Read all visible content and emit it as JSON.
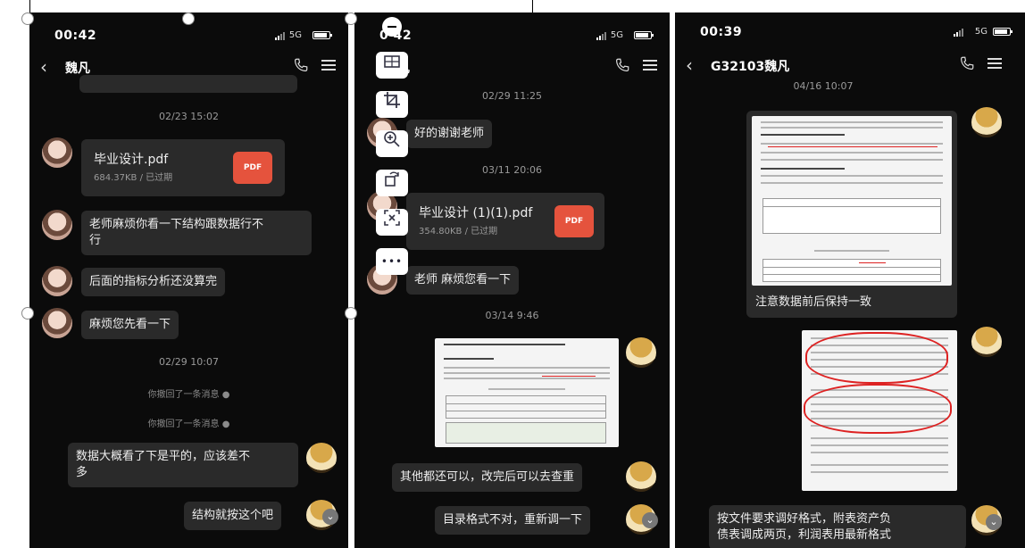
{
  "panel1": {
    "time": "00:42",
    "network": "5G",
    "contact": "魏凡",
    "timestamp1": "02/23 15:02",
    "file": {
      "name": "毕业设计.pdf",
      "meta": "684.37KB / 已过期",
      "icon": "PDF"
    },
    "msg1": "老师麻烦你看一下结构跟数据行不行",
    "msg1_line1": "老师麻烦你看一下结构跟数据行不",
    "msg1_line2": "行",
    "msg2": "后面的指标分析还没算完",
    "msg3": "麻烦您先看一下",
    "timestamp2": "02/29 10:07",
    "recall1": "你撤回了一条消息",
    "recall2": "你撤回了一条消息",
    "msg4_line1": "数据大概看了下是平的，应该差不",
    "msg4_line2": "多",
    "msg5": "结构就按这个吧"
  },
  "panel2": {
    "time": "0 42",
    "network": "5G",
    "contact": "凡",
    "timestamp1": "02/29 11:25",
    "msg1": "好的谢谢老师",
    "timestamp2": "03/11 20:06",
    "file": {
      "name": "毕业设计 (1)(1).pdf",
      "meta": "354.80KB / 已过期",
      "icon": "PDF"
    },
    "msg2": "老师 麻烦您看一下",
    "timestamp3": "03/14 9:46",
    "msg3": "其他都还可以，改完后可以去查重",
    "msg4": "目录格式不对，重新调一下"
  },
  "panel3": {
    "time": "00:39",
    "network": "5G",
    "contact": "G32103魏凡",
    "timestamp1": "04/16 10:07",
    "msg1": "注意数据前后保持一致",
    "msg2_line1": "按文件要求调好格式，附表资产负",
    "msg2_line2": "债表调成两页，利润表用最新格式"
  },
  "tools": [
    "minus-icon",
    "crop-panel-icon",
    "crop-icon",
    "zoom-in-icon",
    "rotate-icon",
    "fit-icon",
    "more-icon"
  ],
  "tools_more_label": "•••",
  "colors": {
    "bubble": "#2a2a2a",
    "pdf": "#e5533d",
    "bg": "#0b0b0b"
  }
}
